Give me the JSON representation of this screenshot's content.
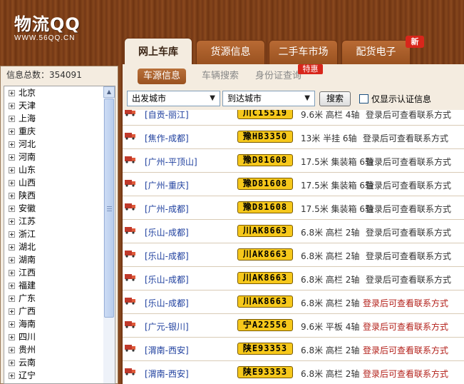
{
  "logo": {
    "main": "物流QQ",
    "sub": "WWW.56QQ.CN"
  },
  "tabs": [
    {
      "label": "网上车库",
      "active": true
    },
    {
      "label": "货源信息",
      "active": false
    },
    {
      "label": "二手车市场",
      "active": false
    },
    {
      "label": "配货电子",
      "active": false
    }
  ],
  "tab_badge": "新",
  "sidebar": {
    "info_total_label": "信息总数：",
    "info_total_value": "354091",
    "provinces": [
      "北京",
      "天津",
      "上海",
      "重庆",
      "河北",
      "河南",
      "山东",
      "山西",
      "陕西",
      "安徽",
      "江苏",
      "浙江",
      "湖北",
      "湖南",
      "江西",
      "福建",
      "广东",
      "广西",
      "海南",
      "四川",
      "贵州",
      "云南",
      "辽宁"
    ]
  },
  "subtabs": [
    {
      "label": "车源信息",
      "active": true
    },
    {
      "label": "车辆搜索",
      "active": false
    },
    {
      "label": "身份证查询",
      "active": false
    }
  ],
  "subtab_badge": "特惠",
  "filters": {
    "from_city": "出发城市",
    "to_city": "到达城市",
    "search_label": "搜索",
    "verified_only_label": "仅显示认证信息",
    "verified_only_checked": false
  },
  "vehicles": [
    {
      "route": "[自贡-丽江]",
      "plate": "川C15519",
      "spec": "9.6米 高栏 4轴",
      "contact": "登录后可查看联系方式",
      "highlight": false
    },
    {
      "route": "[焦作-成都]",
      "plate": "豫HB3350",
      "spec": "13米 半挂 6轴",
      "contact": "登录后可查看联系方式",
      "highlight": false
    },
    {
      "route": "[广州-平顶山]",
      "plate": "豫D81608",
      "spec": "17.5米 集装箱 6轴",
      "contact": "登录后可查看联系方式",
      "highlight": false
    },
    {
      "route": "[广州-重庆]",
      "plate": "豫D81608",
      "spec": "17.5米 集装箱 6轴",
      "contact": "登录后可查看联系方式",
      "highlight": false
    },
    {
      "route": "[广州-成都]",
      "plate": "豫D81608",
      "spec": "17.5米 集装箱 6轴",
      "contact": "登录后可查看联系方式",
      "highlight": false
    },
    {
      "route": "[乐山-成都]",
      "plate": "川AK8663",
      "spec": "6.8米 高栏 2轴",
      "contact": "登录后可查看联系方式",
      "highlight": false
    },
    {
      "route": "[乐山-成都]",
      "plate": "川AK8663",
      "spec": "6.8米 高栏 2轴",
      "contact": "登录后可查看联系方式",
      "highlight": false
    },
    {
      "route": "[乐山-成都]",
      "plate": "川AK8663",
      "spec": "6.8米 高栏 2轴",
      "contact": "登录后可查看联系方式",
      "highlight": false
    },
    {
      "route": "[乐山-成都]",
      "plate": "川AK8663",
      "spec": "6.8米 高栏 2轴",
      "contact": "登录后可查看联系方式",
      "highlight": true
    },
    {
      "route": "[广元-银川]",
      "plate": "宁A22556",
      "spec": "9.6米 平板 4轴",
      "contact": "登录后可查看联系方式",
      "highlight": true
    },
    {
      "route": "[渭南-西安]",
      "plate": "陕E93353",
      "spec": "6.8米 高栏 2轴",
      "contact": "登录后可查看联系方式",
      "highlight": true
    },
    {
      "route": "[渭南-西安]",
      "plate": "陕E93353",
      "spec": "6.8米 高栏 2轴",
      "contact": "登录后可查看联系方式",
      "highlight": true
    }
  ],
  "colors": {
    "accent": "#9a5220",
    "plate": "#f6c81b",
    "route": "#1e3f9e",
    "contact_highlight": "#b3201a",
    "badge": "#d8261b"
  }
}
